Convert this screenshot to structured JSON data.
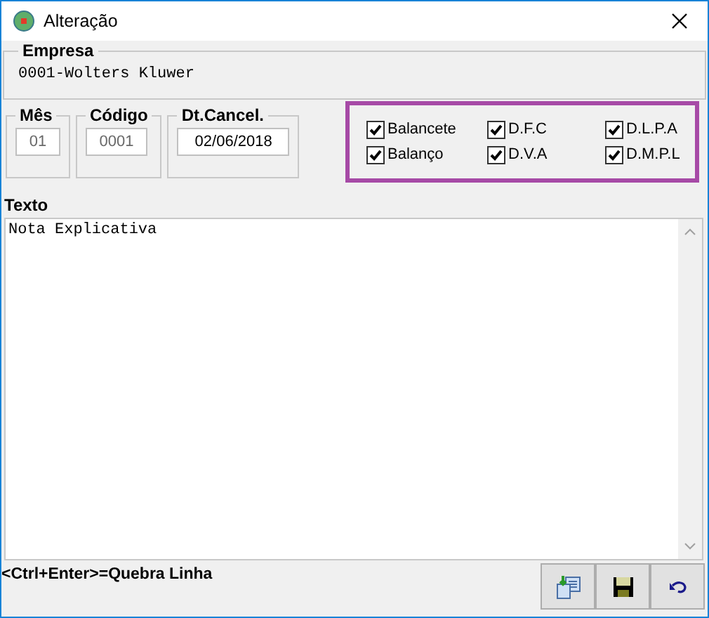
{
  "window": {
    "title": "Alteração"
  },
  "empresa": {
    "label": "Empresa",
    "value": "0001-Wolters Kluwer"
  },
  "fields": [
    {
      "label": "Mês",
      "value": "01",
      "disabled": true
    },
    {
      "label": "Código",
      "value": "0001",
      "disabled": true
    },
    {
      "label": "Dt.Cancel.",
      "value": "02/06/2018",
      "disabled": false
    }
  ],
  "checkboxes": [
    {
      "label": "Balancete",
      "checked": true
    },
    {
      "label": "D.F.C",
      "checked": true
    },
    {
      "label": "D.L.P.A",
      "checked": true
    },
    {
      "label": "Balanço",
      "checked": true
    },
    {
      "label": "D.V.A",
      "checked": true
    },
    {
      "label": "D.M.P.L",
      "checked": true
    }
  ],
  "texto": {
    "label": "Texto",
    "value": "Nota Explicativa"
  },
  "hint": "<Ctrl+Enter>=Quebra Linha"
}
